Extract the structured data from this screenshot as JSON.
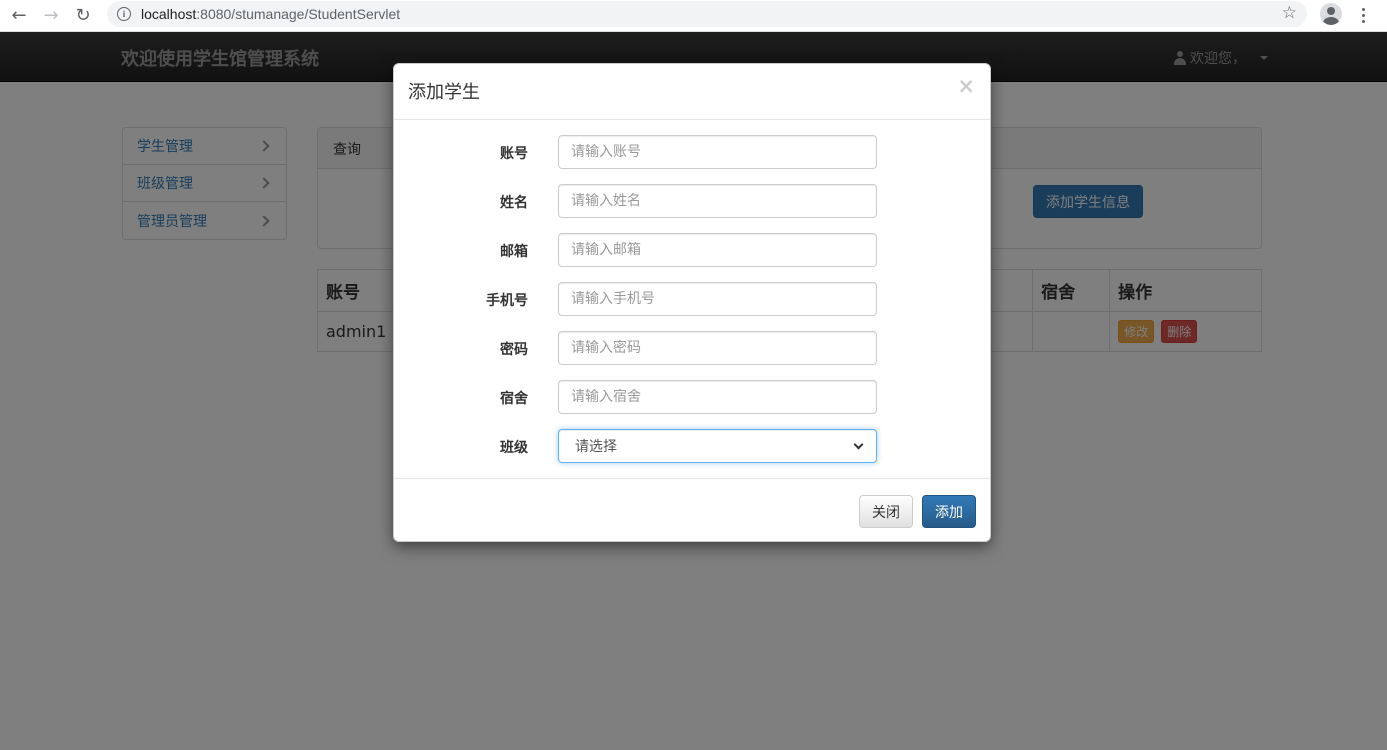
{
  "browser": {
    "url_host": "localhost",
    "url_path": ":8080/stumanage/StudentServlet"
  },
  "navbar": {
    "brand": "欢迎使用学生馆管理系统",
    "user_label": "欢迎您，"
  },
  "sidebar": {
    "items": [
      {
        "label": "学生管理"
      },
      {
        "label": "班级管理"
      },
      {
        "label": "管理员管理"
      }
    ]
  },
  "query_panel": {
    "title": "查询",
    "add_button": "添加学生信息"
  },
  "table": {
    "headers": {
      "account": "账号",
      "dorm": "宿舍",
      "ops": "操作"
    },
    "rows": [
      {
        "account": "admin1",
        "dorm": "",
        "edit": "修改",
        "delete": "删除"
      }
    ]
  },
  "modal": {
    "title": "添加学生",
    "close_glyph": "×",
    "fields": [
      {
        "label": "账号",
        "placeholder": "请输入账号"
      },
      {
        "label": "姓名",
        "placeholder": "请输入姓名"
      },
      {
        "label": "邮箱",
        "placeholder": "请输入邮箱"
      },
      {
        "label": "手机号",
        "placeholder": "请输入手机号"
      },
      {
        "label": "密码",
        "placeholder": "请输入密码"
      },
      {
        "label": "宿舍",
        "placeholder": "请输入宿舍"
      }
    ],
    "class_field": {
      "label": "班级",
      "selected": "请选择"
    },
    "close_button": "关闭",
    "submit_button": "添加"
  },
  "colors": {
    "primary": "#337ab7",
    "navbar": "#222222",
    "warning": "#f0ad4e",
    "danger": "#d9534f"
  }
}
